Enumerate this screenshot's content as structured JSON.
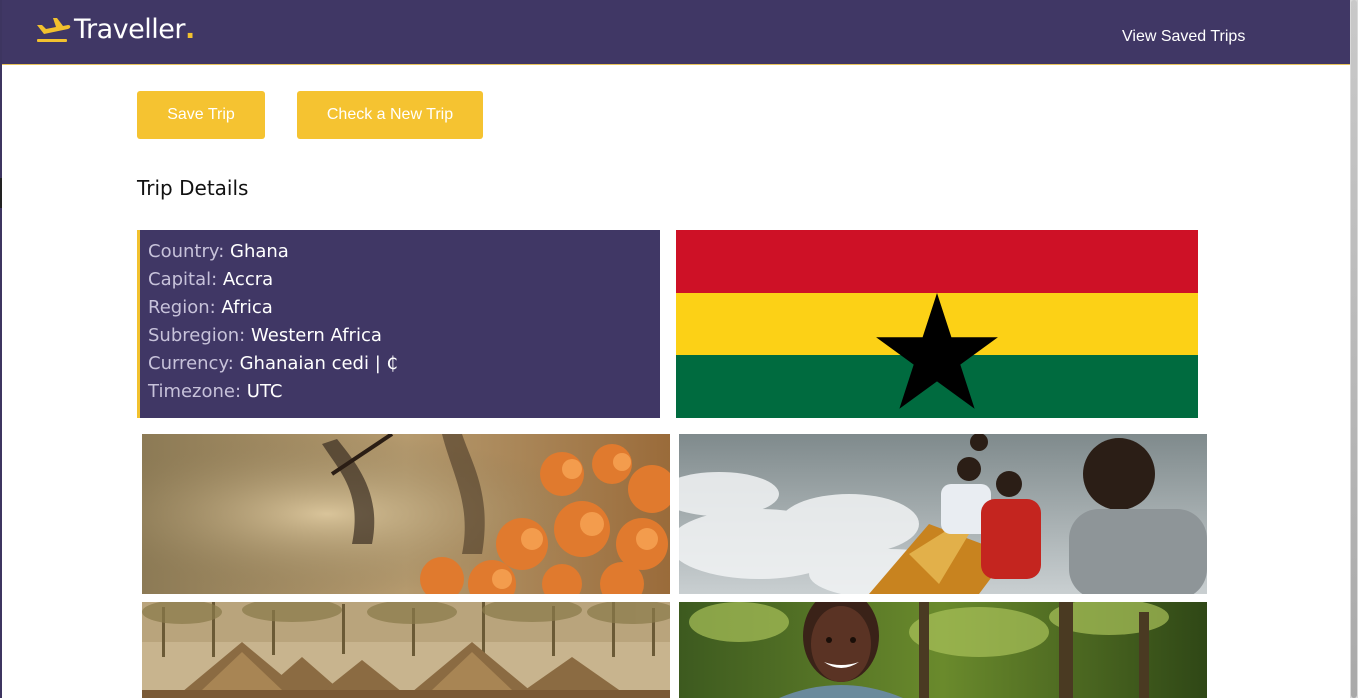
{
  "header": {
    "brand_name": "Traveller",
    "brand_dot": ".",
    "nav_link": "View Saved Trips"
  },
  "actions": {
    "save_label": "Save Trip",
    "new_label": "Check a New Trip"
  },
  "section_title": "Trip Details",
  "details": [
    {
      "label": "Country:",
      "value": "Ghana"
    },
    {
      "label": "Capital:",
      "value": "Accra"
    },
    {
      "label": "Region:",
      "value": "Africa"
    },
    {
      "label": "Subregion:",
      "value": "Western Africa"
    },
    {
      "label": "Currency:",
      "value": "Ghanaian cedi | ₵"
    },
    {
      "label": "Timezone:",
      "value": "UTC"
    }
  ],
  "flag": {
    "stripe_colors": [
      "#ce1126",
      "#fcd116",
      "#006b3f"
    ],
    "star_color": "#000000"
  },
  "colors": {
    "header_bg": "#403765",
    "accent": "#f5c331",
    "card_bg": "#403765"
  },
  "photos": [
    {
      "icon": "flowers-photo"
    },
    {
      "icon": "canoe-photo"
    },
    {
      "icon": "village-photo"
    },
    {
      "icon": "smiling-woman-photo"
    }
  ]
}
